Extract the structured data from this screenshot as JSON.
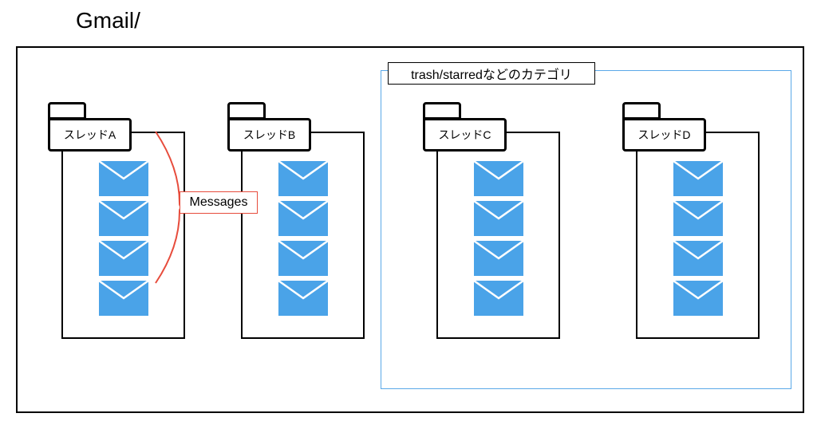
{
  "title": "Gmail/",
  "category_label": "trash/starredなどのカテゴリ",
  "messages_label": "Messages",
  "threads": [
    {
      "id": "a",
      "label": "スレッドA",
      "message_count": 4
    },
    {
      "id": "b",
      "label": "スレッドB",
      "message_count": 4
    },
    {
      "id": "c",
      "label": "スレッドC",
      "message_count": 4
    },
    {
      "id": "d",
      "label": "スレッドD",
      "message_count": 4
    }
  ],
  "colors": {
    "envelope": "#4aa3e8",
    "category_border": "#5aa8e8",
    "bracket": "#e74c3c"
  }
}
